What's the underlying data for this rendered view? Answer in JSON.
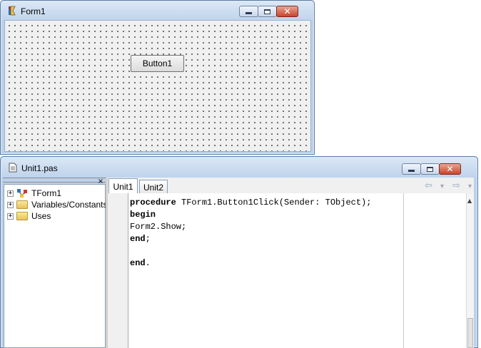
{
  "form_window": {
    "title": "Form1",
    "icon": "delphi-form-icon",
    "controls": [
      "minimize-icon",
      "maximize-icon",
      "close-icon"
    ],
    "button_label": "Button1"
  },
  "unit_window": {
    "title": "Unit1.pas",
    "icon": "document-icon",
    "tree": {
      "close_glyph": "×",
      "items": [
        {
          "label": "TForm1",
          "icon": "class-icon",
          "expander": "+"
        },
        {
          "label": "Variables/Constants",
          "icon": "folder-icon",
          "expander": "+"
        },
        {
          "label": "Uses",
          "icon": "folder-icon",
          "expander": "+"
        }
      ]
    },
    "tabs": [
      {
        "label": "Unit1",
        "active": true
      },
      {
        "label": "Unit2",
        "active": false
      }
    ],
    "nav": {
      "back": "⇦",
      "back_dropdown": "▾",
      "forward": "⇨",
      "forward_dropdown": "▾"
    },
    "code_lines": [
      {
        "kw": "procedure",
        "rest": " TForm1.Button1Click(Sender: TObject);"
      },
      {
        "kw": "begin",
        "rest": ""
      },
      {
        "kw": "",
        "rest": "Form2.Show;"
      },
      {
        "kw": "end",
        "rest": ";"
      },
      {
        "kw": "",
        "rest": ""
      },
      {
        "kw": "end",
        "rest": "."
      }
    ]
  },
  "colors": {
    "title_gradient_top": "#dbe7f5",
    "close_button": "#c8452b",
    "editor_background": "#ffffff"
  }
}
